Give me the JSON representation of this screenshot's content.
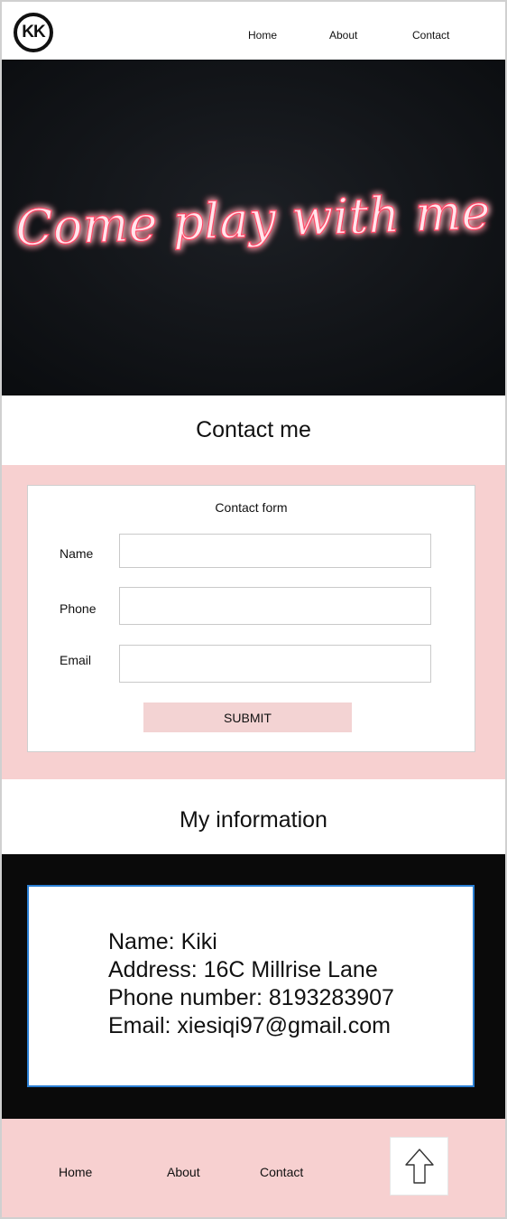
{
  "header": {
    "logo_text": "KK",
    "nav": [
      "Home",
      "About",
      "Contact"
    ]
  },
  "hero": {
    "neon_text": "Come play with me"
  },
  "contact_section": {
    "title": "Contact me",
    "form": {
      "title": "Contact form",
      "name_label": "Name",
      "phone_label": "Phone",
      "email_label": "Email",
      "name_value": "",
      "phone_value": "",
      "email_value": "",
      "submit_label": "SUBMIT"
    }
  },
  "info_section": {
    "title": "My information",
    "lines": [
      "Name: Kiki",
      "Address: 16C Millrise Lane",
      "Phone number: 8193283907",
      "Email: xiesiqi97@gmail.com"
    ]
  },
  "footer": {
    "nav": [
      "Home",
      "About",
      "Contact"
    ],
    "back_to_top_icon": "arrow-up-icon"
  },
  "colors": {
    "pink": "#f7d0d0",
    "dark": "#0a0a0a",
    "info_border": "#2a7fd4",
    "neon": "#ff3a5e"
  }
}
